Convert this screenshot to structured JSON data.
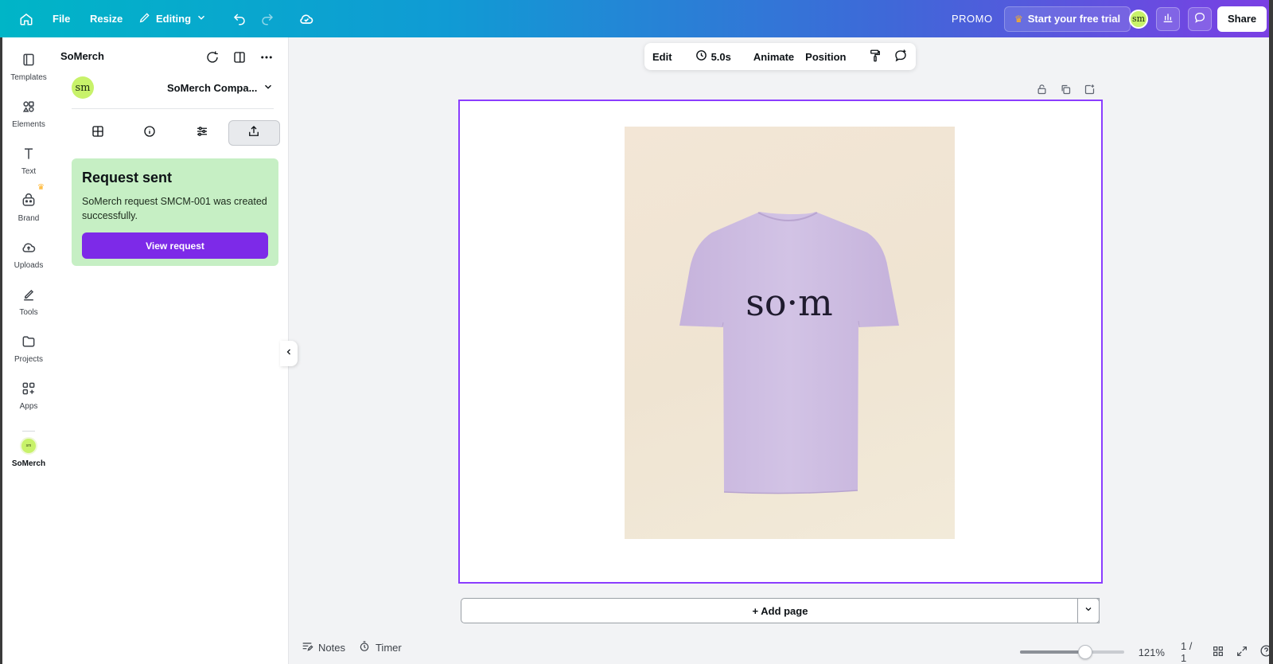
{
  "topbar": {
    "file": "File",
    "resize": "Resize",
    "editing": "Editing",
    "promo": "PROMO",
    "trial": "Start your free trial",
    "avatar": "sm",
    "share": "Share"
  },
  "rail": {
    "items": [
      {
        "label": "Templates",
        "icon": "templates-icon"
      },
      {
        "label": "Elements",
        "icon": "elements-icon"
      },
      {
        "label": "Text",
        "icon": "text-icon"
      },
      {
        "label": "Brand",
        "icon": "brand-icon"
      },
      {
        "label": "Uploads",
        "icon": "uploads-icon"
      },
      {
        "label": "Tools",
        "icon": "tools-icon"
      },
      {
        "label": "Projects",
        "icon": "projects-icon"
      },
      {
        "label": "Apps",
        "icon": "apps-icon"
      },
      {
        "label": "SoMerch",
        "icon": "somerch-app-icon"
      }
    ]
  },
  "panel": {
    "title": "SoMerch",
    "company_avatar": "sm",
    "company": "SoMerch Compa...",
    "card": {
      "title": "Request sent",
      "body": "SoMerch request SMCM-001 was created successfully.",
      "button": "View request"
    }
  },
  "toolbar": {
    "edit": "Edit",
    "duration": "5.0s",
    "animate": "Animate",
    "position": "Position"
  },
  "canvas": {
    "shirt_text": "so·m",
    "shirt_color": "#cdbde2",
    "add_page": "+ Add page"
  },
  "bottom": {
    "notes": "Notes",
    "timer": "Timer",
    "zoom": "121%",
    "zoom_fraction": 0.62,
    "pages": "1 / 1"
  },
  "colors": {
    "accent": "#7d2ae8",
    "selection": "#8b3dff",
    "success_bg": "#c6efc4"
  }
}
